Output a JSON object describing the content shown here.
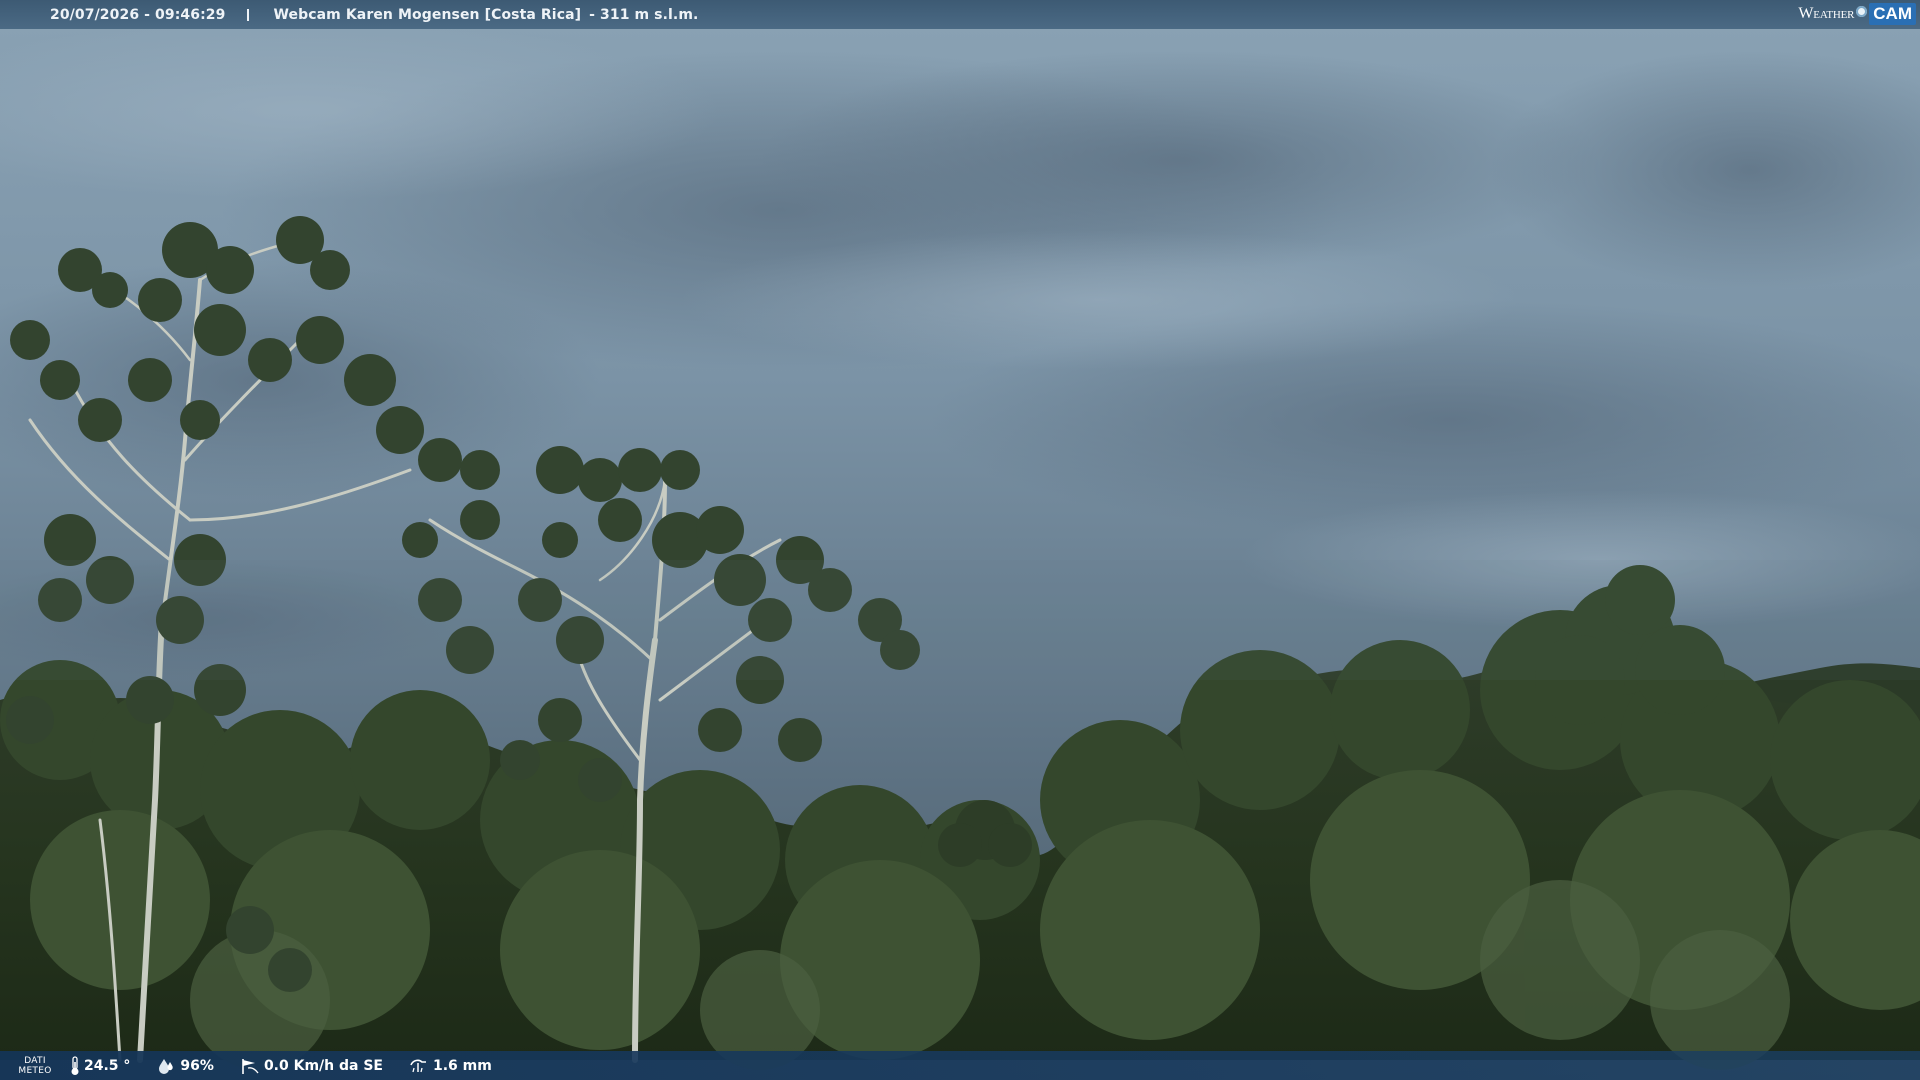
{
  "header": {
    "datetime": "20/07/2026 - 09:46:29",
    "webcam_name": "Webcam Karen Mogensen [Costa Rica]",
    "altitude": "- 311 m s.l.m."
  },
  "logo": {
    "weather_text": "Weather",
    "cam_text": "CAM"
  },
  "footer": {
    "dati_line1": "DATI",
    "dati_line2": "METEO",
    "temperature": "24.5 °",
    "humidity": "96%",
    "wind": "0.0 Km/h da SE",
    "rain": "1.6 mm"
  },
  "icons": {
    "temperature": "thermometer-icon",
    "humidity": "humidity-drop-icon",
    "wind": "wind-icon",
    "rain": "rain-icon"
  },
  "colors": {
    "sky": "#7f98aa",
    "foliage": "#2c3a26",
    "bar_top": "#3f6282",
    "bar_bottom": "#183a5e",
    "logo_cam": "#2a6fb4"
  }
}
